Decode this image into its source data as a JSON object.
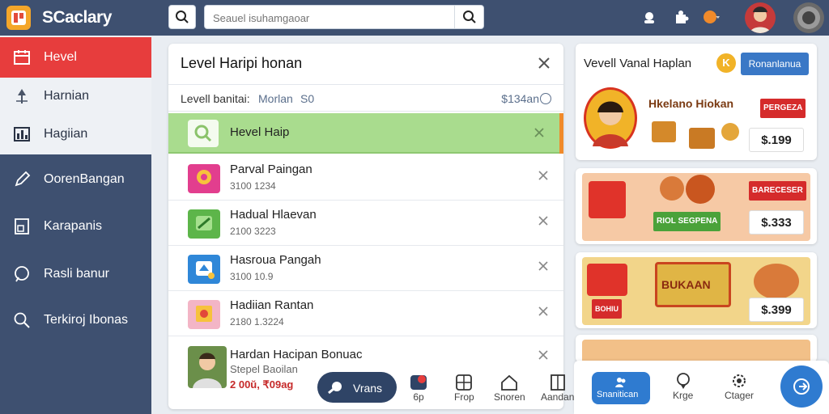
{
  "app": {
    "brand": "SCaclary"
  },
  "search": {
    "placeholder": "Seauel isuhamgaoar"
  },
  "sidebar": {
    "items": [
      {
        "label": "Hevel",
        "icon": "calendar-icon"
      },
      {
        "label": "Harnian",
        "icon": "pin-icon"
      },
      {
        "label": "Hagiian",
        "icon": "chart-icon"
      },
      {
        "label": "OorenBangan",
        "icon": "edit-icon"
      },
      {
        "label": "Karapanis",
        "icon": "document-icon"
      },
      {
        "label": "Rasli banur",
        "icon": "chat-icon"
      },
      {
        "label": "Terkiroj Ibonas",
        "icon": "search-icon"
      }
    ]
  },
  "panel": {
    "title": "Level Haripi honan",
    "sub_a": "Levell banitai:",
    "sub_b": "Morlan",
    "sub_c": "S0",
    "sub_d": "$134an",
    "highlight": {
      "label": "Hevel Haip"
    },
    "rows": [
      {
        "title": "Parval Paingan",
        "meta": "3100 1234",
        "color": "#e23e8e"
      },
      {
        "title": "Hadual Hlaevan",
        "meta": "2100 3223",
        "color": "#5db54a"
      },
      {
        "title": "Hasroua Pangah",
        "meta": "3100 10.9",
        "color": "#2f87d8"
      },
      {
        "title": "Hadiian Rantan",
        "meta": "2180 1.3224",
        "color": "#f3b5c6"
      },
      {
        "title": "Hardan Hacipan Bonuac",
        "meta": "Stepel Baoilan",
        "meta2": "2 00ŭ, ₹09ag",
        "color": "#6b8f4a"
      }
    ]
  },
  "bottom_nav_left": {
    "pill": "Vrans",
    "items": [
      {
        "label": "6p",
        "icon": "badge-icon"
      },
      {
        "label": "Frop",
        "icon": "grid-icon"
      },
      {
        "label": "Snoren",
        "icon": "home-icon"
      },
      {
        "label": "Aandan",
        "icon": "bookmark-icon"
      }
    ]
  },
  "right": {
    "title": "Vevell Vanal Haplan",
    "coin": "K",
    "button": "Ronanlanua",
    "cards": [
      {
        "heading": "Hkelano Hiokan",
        "price": "$.199",
        "tag": "PERGEZA"
      },
      {
        "heading": "RIOL SEGPENA",
        "price": "$.333",
        "tag": "BARECESER"
      },
      {
        "heading": "BUKAAN",
        "price": "$.399",
        "tag": "BOHIU"
      }
    ]
  },
  "bottom_nav_right": {
    "pill": "Snanitican",
    "items": [
      {
        "label": "Krge",
        "icon": "pin-icon"
      },
      {
        "label": "Ctager",
        "icon": "gear-icon"
      }
    ]
  },
  "colors": {
    "accent": "#e73d3d",
    "navy": "#3e5070",
    "highlight": "#a9dc8e",
    "blue": "#2f7bd0"
  }
}
